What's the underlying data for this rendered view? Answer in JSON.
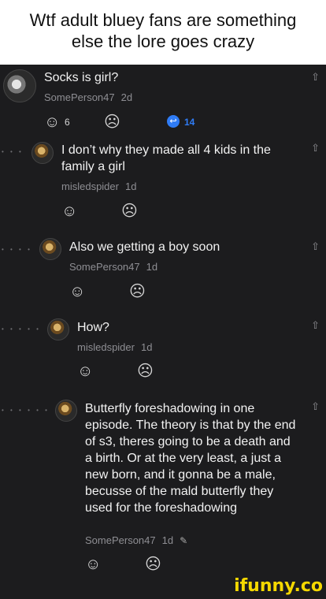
{
  "meme": {
    "caption_line1": "Wtf adult bluey fans are something",
    "caption_line2": "else the lore goes crazy"
  },
  "comments": [
    {
      "text": "Socks is girl?",
      "user": "SomePerson47",
      "time": "2d",
      "like_count": "6",
      "reply_count": "14"
    },
    {
      "text": "I don’t why they made all 4 kids in the family a girl",
      "user": "misledspider",
      "time": "1d"
    },
    {
      "text": "Also we getting a boy soon",
      "user": "SomePerson47",
      "time": "1d"
    },
    {
      "text": "How?",
      "user": "misledspider",
      "time": "1d"
    },
    {
      "text": "Butterfly foreshadowing in one episode. The theory is that by the end of s3, theres going to be a death and a birth. Or at the very least, a just a new born, and it gonna be a male, becusse of the mald butterfly they used for the foreshadowing",
      "user": "SomePerson47",
      "time": "1d"
    }
  ],
  "icons": {
    "like": "smile-face-icon",
    "dislike": "frown-face-icon",
    "reply": "reply-icon",
    "share": "share-icon",
    "edit": "pencil-icon"
  },
  "watermark": "ifunny.co",
  "colors": {
    "background": "#1c1c1e",
    "accent": "#2f7cf6",
    "watermark": "#f5d800"
  }
}
